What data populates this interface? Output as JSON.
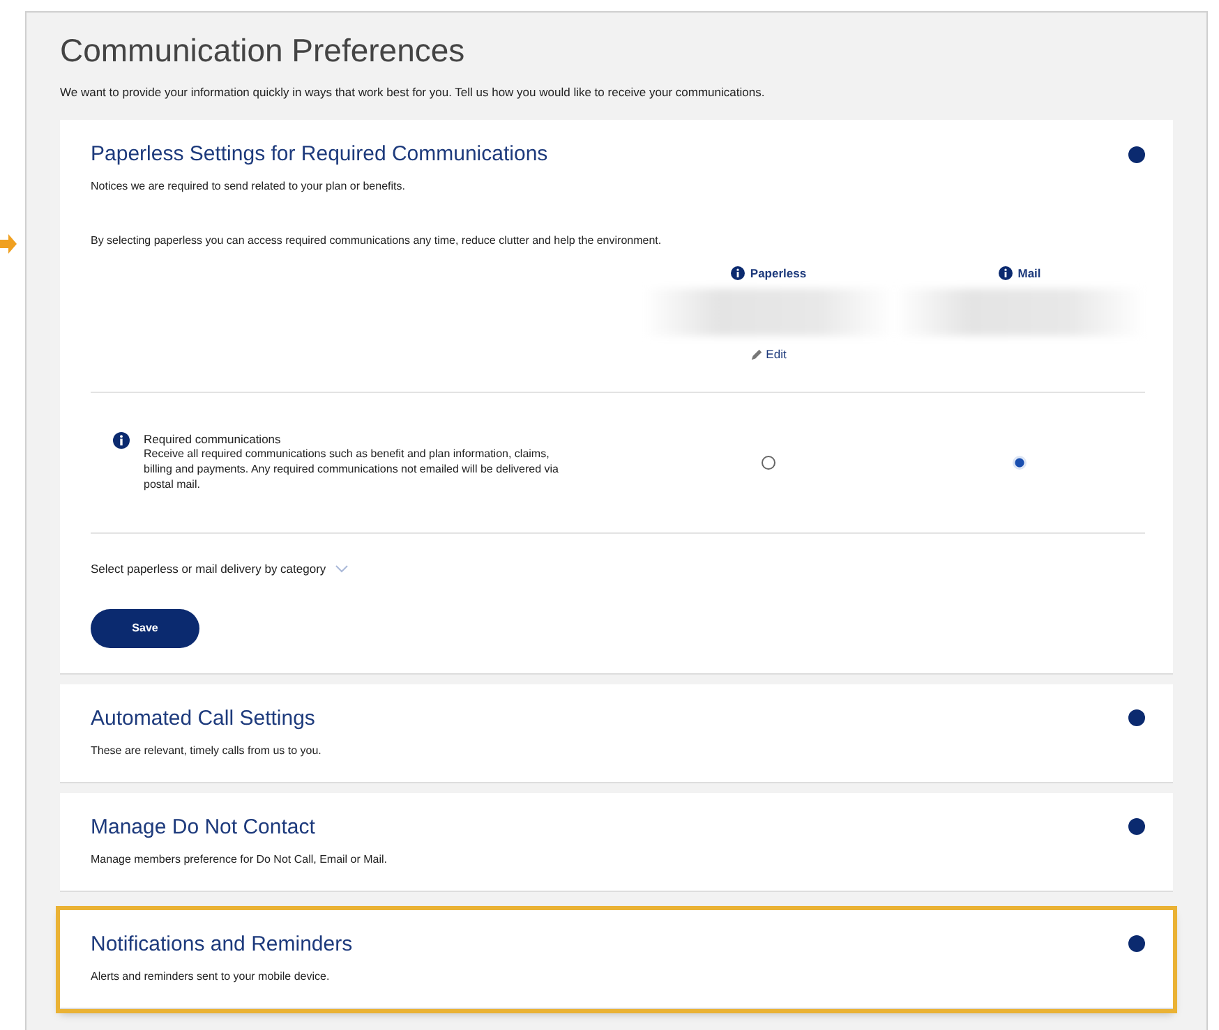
{
  "page": {
    "title": "Communication Preferences",
    "intro": "We want to provide your information quickly in ways that work best for you. Tell us how you would like to receive your communications."
  },
  "paperless_section": {
    "title": "Paperless Settings for Required Communications",
    "subtitle": "Notices we are required to send related to your plan or benefits.",
    "note": "By selecting paperless you can access required communications any time, reduce clutter and help the environment.",
    "columns": [
      {
        "label": "Paperless"
      },
      {
        "label": "Mail"
      }
    ],
    "edit_link": "Edit",
    "rows": [
      {
        "title": "Required communications",
        "description": "Receive all required communications such as benefit and plan information, claims, billing and payments. Any required communications not emailed will be delivered via postal mail.",
        "options": [
          {
            "selected": false
          },
          {
            "selected": true
          }
        ]
      }
    ],
    "category_toggle": "Select paperless or mail delivery by category",
    "save_button": "Save"
  },
  "sections": [
    {
      "title": "Automated Call Settings",
      "subtitle": "These are relevant, timely calls from us to you.",
      "highlighted": false
    },
    {
      "title": "Manage Do Not Contact",
      "subtitle": "Manage members preference for Do Not Call, Email or Mail.",
      "highlighted": false
    },
    {
      "title": "Notifications and Reminders",
      "subtitle": "Alerts and reminders sent to your mobile device.",
      "highlighted": true
    }
  ]
}
